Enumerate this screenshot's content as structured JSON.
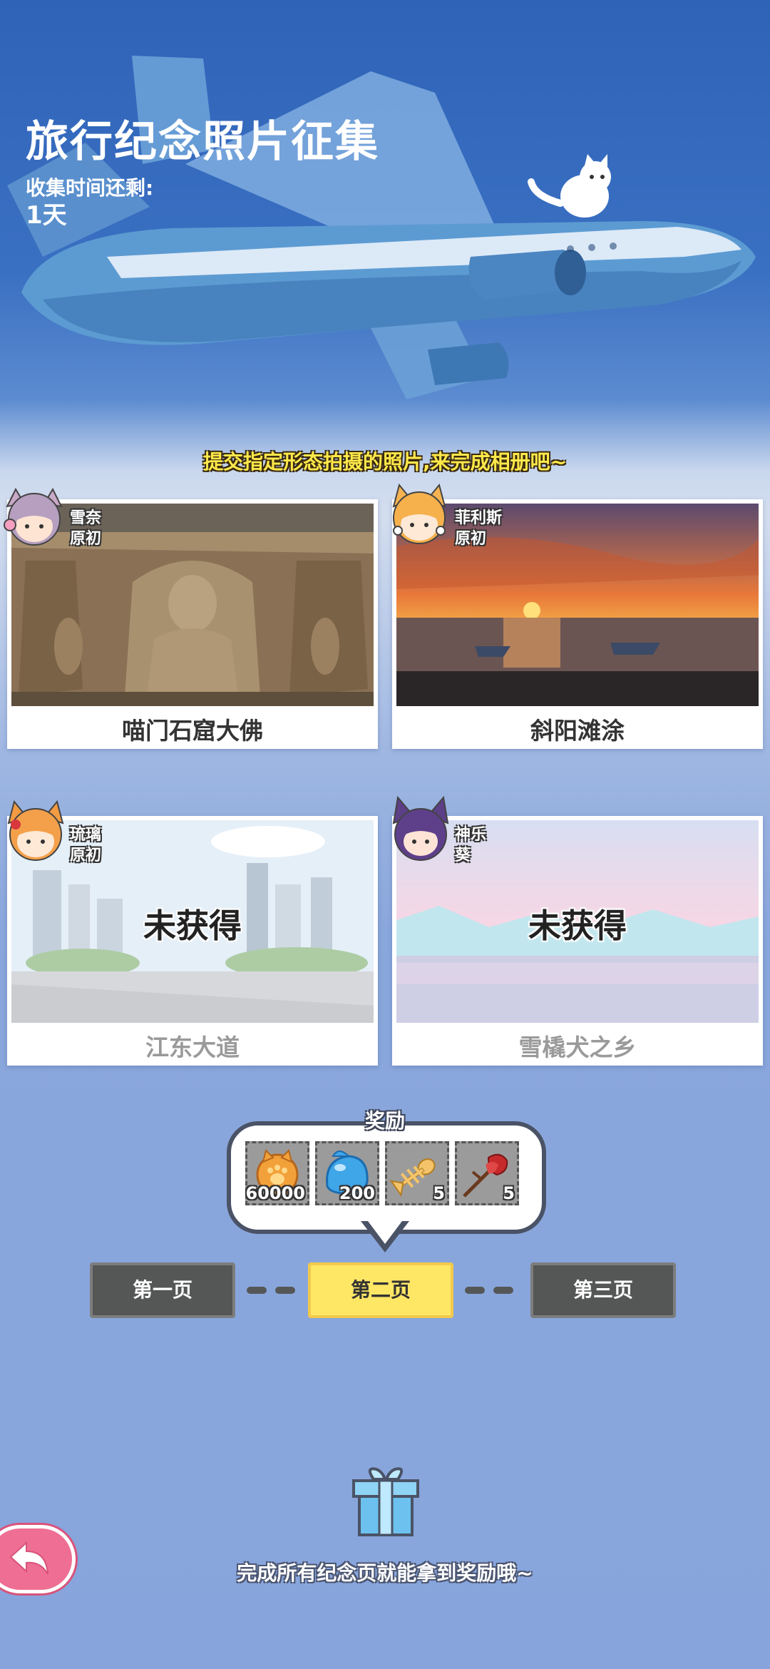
{
  "header": {
    "title": "旅行纪念照片征集",
    "time_label": "收集时间还剩:",
    "time_value": "1天"
  },
  "instruction": "提交指定形态拍摄的照片,来完成相册吧~",
  "cards": [
    {
      "character_name": "雪奈",
      "character_form": "原初",
      "title": "喵门石窟大佛",
      "locked": false
    },
    {
      "character_name": "菲利斯",
      "character_form": "原初",
      "title": "斜阳滩涂",
      "locked": false
    },
    {
      "character_name": "琉璃",
      "character_form": "原初",
      "title": "江东大道",
      "locked": true,
      "locked_label": "未获得"
    },
    {
      "character_name": "神乐",
      "character_form": "葵",
      "title": "雪橇犬之乡",
      "locked": true,
      "locked_label": "未获得"
    }
  ],
  "reward": {
    "label": "奖励",
    "items": [
      {
        "icon": "cat-paw-coin-icon",
        "count": "60000"
      },
      {
        "icon": "blue-slime-icon",
        "count": "200"
      },
      {
        "icon": "fish-bone-icon",
        "count": "5"
      },
      {
        "icon": "red-flower-icon",
        "count": "5"
      }
    ]
  },
  "pager": {
    "pages": [
      "第一页",
      "第二页",
      "第三页"
    ],
    "active_index": 1
  },
  "footer": {
    "text": "完成所有纪念页就能拿到奖励哦~",
    "gift_icon": "gift-box-icon",
    "back_icon": "back-arrow-icon"
  },
  "colors": {
    "accent_yellow": "#ffe766",
    "button_dark": "#555757",
    "back_pink": "#ee6f93",
    "instruction_yellow": "#ffe94a"
  }
}
